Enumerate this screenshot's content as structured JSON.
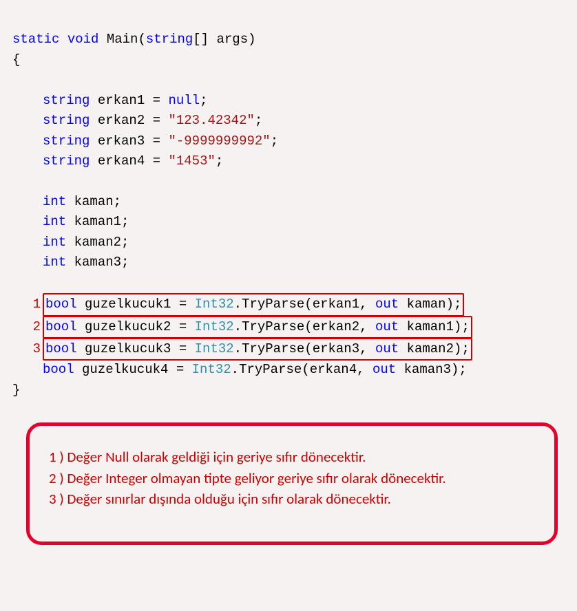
{
  "code": {
    "sig": {
      "static": "static",
      "void": "void",
      "main": "Main",
      "string": "string",
      "brackets": "[]",
      "args": "args"
    },
    "braceOpen": "{",
    "braceClose": "}",
    "decl": {
      "string": "string",
      "e1": "erkan1",
      "e2": "erkan2",
      "e3": "erkan3",
      "e4": "erkan4",
      "eq": "=",
      "null": "null",
      "v2": "\"123.42342\"",
      "v3": "\"-9999999992\"",
      "v4": "\"1453\"",
      "semi": ";"
    },
    "ints": {
      "int": "int",
      "k0": "kaman",
      "k1": "kaman1",
      "k2": "kaman2",
      "k3": "kaman3"
    },
    "parse": {
      "num1": "1",
      "num2": "2",
      "num3": "3",
      "bool": "bool",
      "g1": "guzelkucuk1",
      "g2": "guzelkucuk2",
      "g3": "guzelkucuk3",
      "g4": "guzelkucuk4",
      "eq": "=",
      "int32": "Int32",
      "tryparse": ".TryParse(",
      "comma": ", ",
      "out": "out",
      "close": ");"
    }
  },
  "note": {
    "l1": "1 ) Değer Null olarak geldiği için geriye sıfır dönecektir.",
    "l2": "2 ) Değer Integer olmayan tipte geliyor geriye sıfır olarak dönecektir.",
    "l3": "3 ) Değer sınırlar dışında olduğu için sıfır olarak dönecektir."
  }
}
